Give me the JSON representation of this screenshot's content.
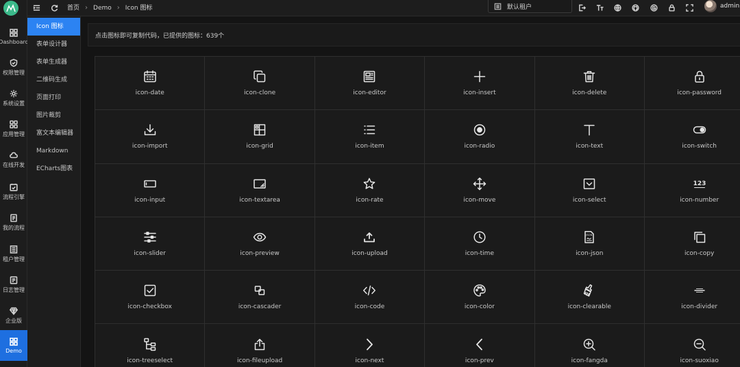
{
  "rail": {
    "items": [
      {
        "label": "Dashboard",
        "icon": "dashboard-icon"
      },
      {
        "label": "权限管理",
        "icon": "shield-icon"
      },
      {
        "label": "系统设置",
        "icon": "gear-icon"
      },
      {
        "label": "应用管理",
        "icon": "apps-icon"
      },
      {
        "label": "在线开发",
        "icon": "cloud-icon"
      },
      {
        "label": "流程引擎",
        "icon": "flow-icon"
      },
      {
        "label": "我的流程",
        "icon": "doc-icon"
      },
      {
        "label": "租户管理",
        "icon": "tenant-icon"
      },
      {
        "label": "日志管理",
        "icon": "log-icon"
      },
      {
        "label": "企业版",
        "icon": "diamond-icon"
      },
      {
        "label": "Demo",
        "icon": "grid-icon"
      }
    ]
  },
  "submenu": {
    "items": [
      "Icon 图标",
      "表单设计器",
      "表单生成器",
      "二维码生成",
      "页面打印",
      "图片裁剪",
      "富文本编辑器",
      "Markdown",
      "ECharts图表"
    ]
  },
  "header": {
    "breadcrumb": [
      "首页",
      "Demo",
      "Icon 图标"
    ],
    "tenant": "默认租户",
    "user": "admin"
  },
  "notice": "点击图标即可复制代码，已提供的图标：639个",
  "icons": [
    {
      "name": "icon-date",
      "icon": "calendar-icon"
    },
    {
      "name": "icon-clone",
      "icon": "clone-icon"
    },
    {
      "name": "icon-editor",
      "icon": "editor-icon"
    },
    {
      "name": "icon-insert",
      "icon": "plus-icon"
    },
    {
      "name": "icon-delete",
      "icon": "trash-icon"
    },
    {
      "name": "icon-password",
      "icon": "lock-icon"
    },
    {
      "name": "icon-import",
      "icon": "download-icon"
    },
    {
      "name": "icon-grid",
      "icon": "grid-layout-icon"
    },
    {
      "name": "icon-item",
      "icon": "list-icon"
    },
    {
      "name": "icon-radio",
      "icon": "radio-icon"
    },
    {
      "name": "icon-text",
      "icon": "text-icon"
    },
    {
      "name": "icon-switch",
      "icon": "switch-icon"
    },
    {
      "name": "icon-input",
      "icon": "input-icon"
    },
    {
      "name": "icon-textarea",
      "icon": "textarea-icon"
    },
    {
      "name": "icon-rate",
      "icon": "star-icon"
    },
    {
      "name": "icon-move",
      "icon": "move-icon"
    },
    {
      "name": "icon-select",
      "icon": "select-icon"
    },
    {
      "name": "icon-number",
      "icon": "number-icon"
    },
    {
      "name": "icon-slider",
      "icon": "slider-icon"
    },
    {
      "name": "icon-preview",
      "icon": "eye-icon"
    },
    {
      "name": "icon-upload",
      "icon": "upload-icon"
    },
    {
      "name": "icon-time",
      "icon": "clock-icon"
    },
    {
      "name": "icon-json",
      "icon": "json-icon"
    },
    {
      "name": "icon-copy",
      "icon": "copy-icon"
    },
    {
      "name": "icon-checkbox",
      "icon": "checkbox-icon"
    },
    {
      "name": "icon-cascader",
      "icon": "cascader-icon"
    },
    {
      "name": "icon-code",
      "icon": "code-icon"
    },
    {
      "name": "icon-color",
      "icon": "palette-icon"
    },
    {
      "name": "icon-clearable",
      "icon": "brush-icon"
    },
    {
      "name": "icon-divider",
      "icon": "divider-icon"
    },
    {
      "name": "icon-treeselect",
      "icon": "tree-icon"
    },
    {
      "name": "icon-fileupload",
      "icon": "file-upload-icon"
    },
    {
      "name": "icon-next",
      "icon": "chevron-right-icon"
    },
    {
      "name": "icon-prev",
      "icon": "chevron-left-icon"
    },
    {
      "name": "icon-fangda",
      "icon": "zoom-in-icon"
    },
    {
      "name": "icon-suoxiao",
      "icon": "zoom-out-icon"
    }
  ],
  "colors": {
    "accent": "#2c83f2",
    "rail_active": "#1e6fe0",
    "logo": "#3bb98a"
  }
}
